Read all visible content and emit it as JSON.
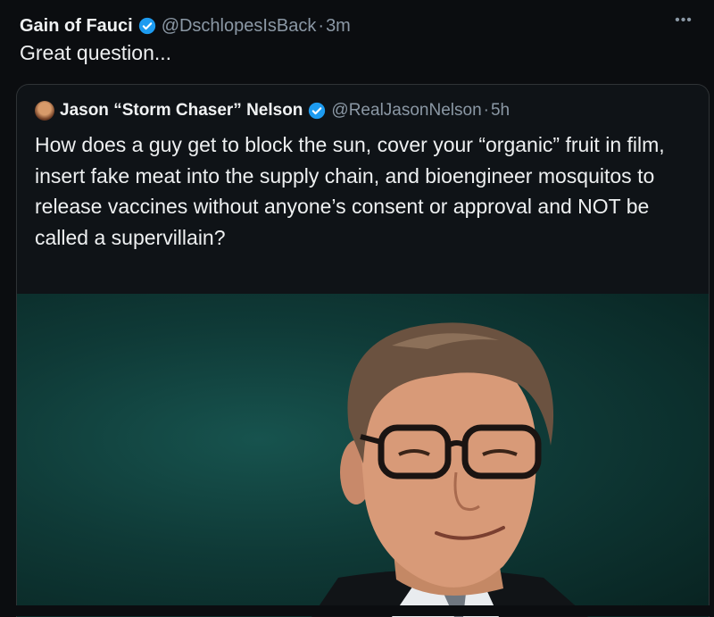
{
  "tweet": {
    "author_name": "Gain of Fauci",
    "author_handle": "@DschlopesIsBack",
    "separator": "·",
    "time": "3m",
    "text": "Great question...",
    "more_icon": "more-options-icon"
  },
  "quoted_tweet": {
    "author_name": "Jason “Storm Chaser” Nelson",
    "author_handle": "@RealJasonNelson",
    "separator": "·",
    "time": "5h",
    "text": "How does a guy get to block the sun, cover your “organic” fruit in film, insert fake meat into the supply chain, and bioengineer mosquitos to release vaccines without anyone’s consent or approval and NOT be called a supervillain?",
    "media_type": "photo"
  },
  "colors": {
    "background": "#0b0d10",
    "verified_badge": "#1d9bf0",
    "secondary_text": "#8b98a5"
  }
}
